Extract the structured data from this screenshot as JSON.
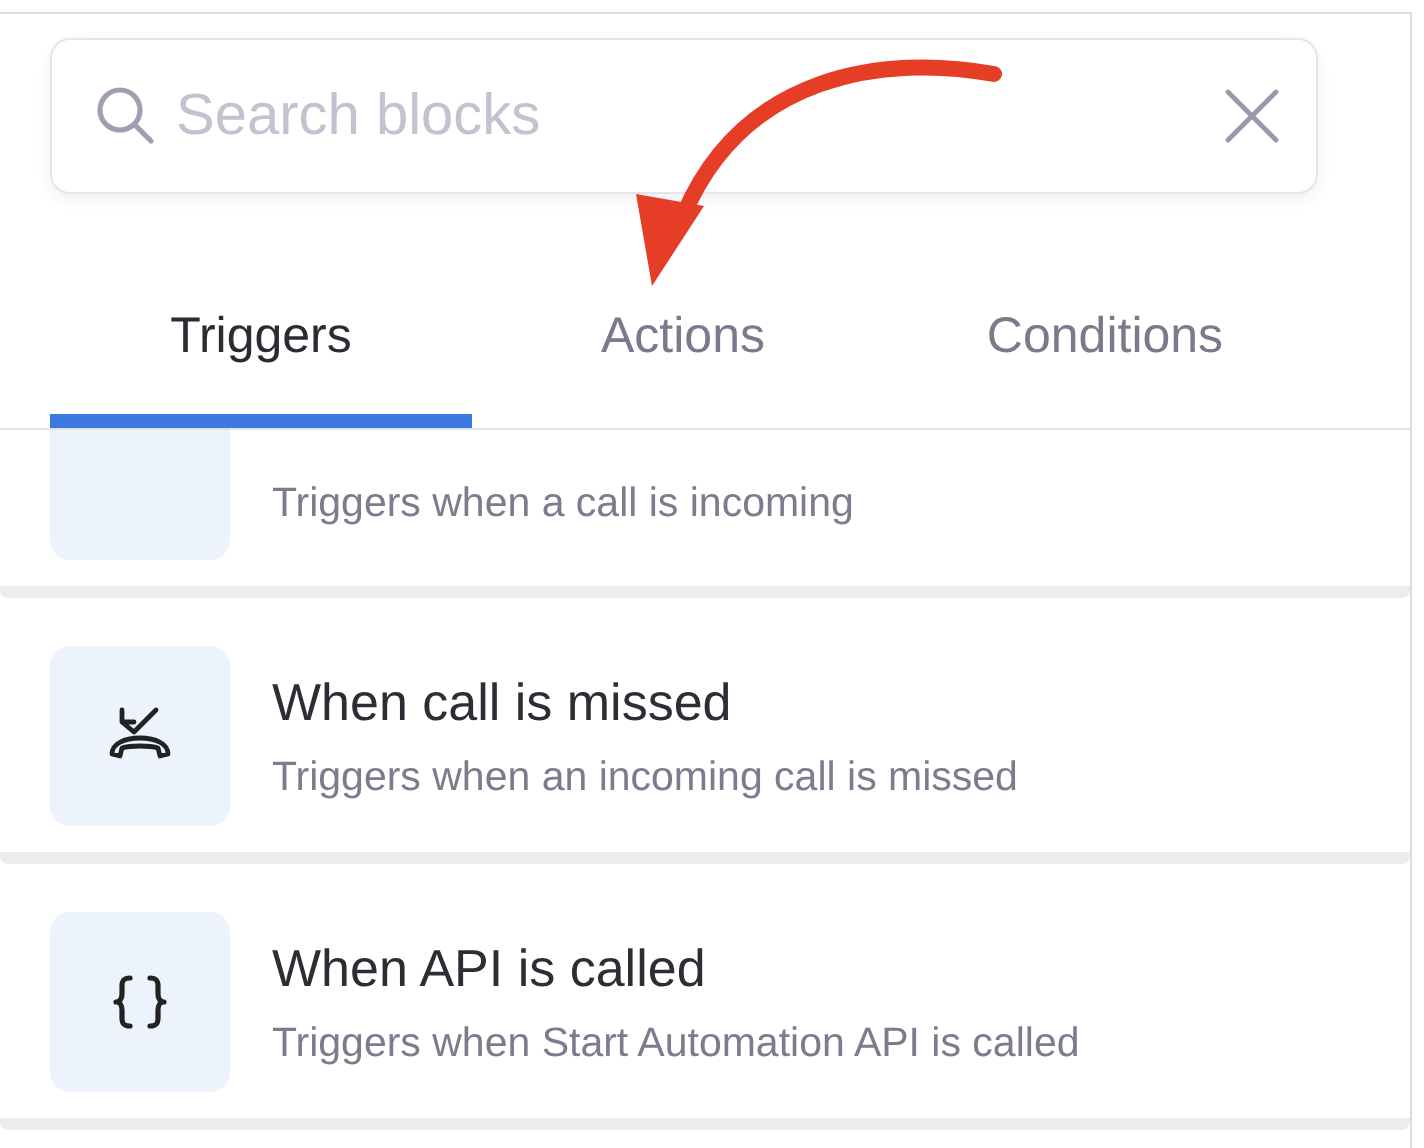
{
  "search": {
    "placeholder": "Search blocks"
  },
  "tabs": [
    {
      "label": "Triggers",
      "selected": true
    },
    {
      "label": "Actions",
      "selected": false
    },
    {
      "label": "Conditions",
      "selected": false
    }
  ],
  "blocks": [
    {
      "kind": "clipped",
      "description": "Triggers when a call is incoming"
    },
    {
      "kind": "missed-call",
      "title": "When call is missed",
      "description": "Triggers when an incoming call is missed"
    },
    {
      "kind": "braces",
      "title": "When API is called",
      "description": "Triggers when Start Automation API is called"
    }
  ]
}
